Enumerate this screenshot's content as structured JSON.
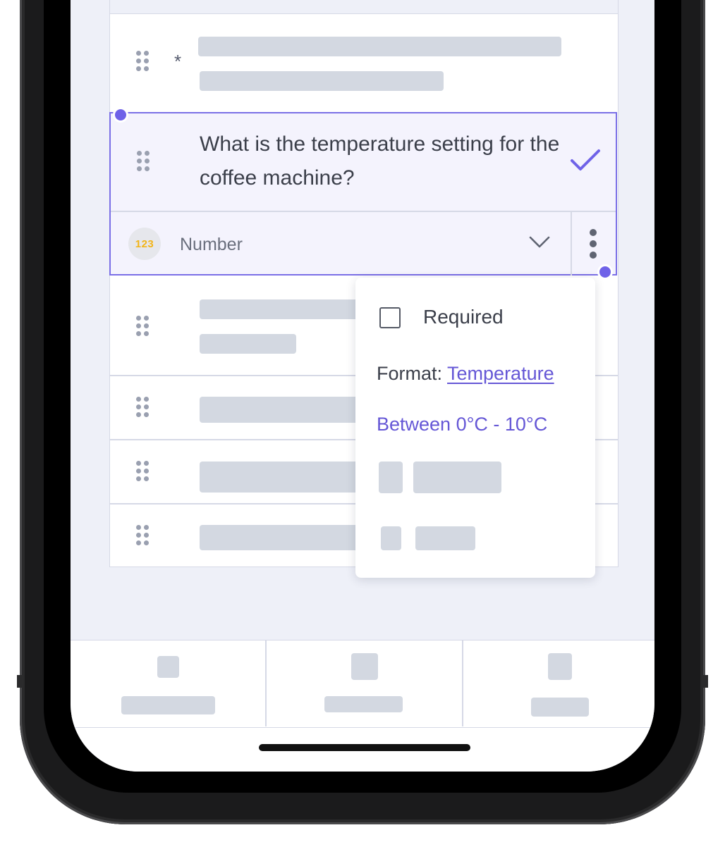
{
  "question": {
    "text": "What is the temperature setting for the coffee machine?",
    "required_marker": "*"
  },
  "answer_type": {
    "badge": "123",
    "label": "Number"
  },
  "menu": {
    "required_label": "Required",
    "required_checked": false,
    "format_prefix": "Format:",
    "format_value": "Temperature",
    "range_text": "Between 0°C - 10°C"
  },
  "colors": {
    "accent": "#6f62e8",
    "link": "#6557d6",
    "badge_text": "#f2b418",
    "skeleton": "#d3d8e1"
  },
  "icons": [
    "drag-handle-icon",
    "checkmark-icon",
    "chevron-down-icon",
    "more-vertical-icon",
    "checkbox-icon"
  ]
}
